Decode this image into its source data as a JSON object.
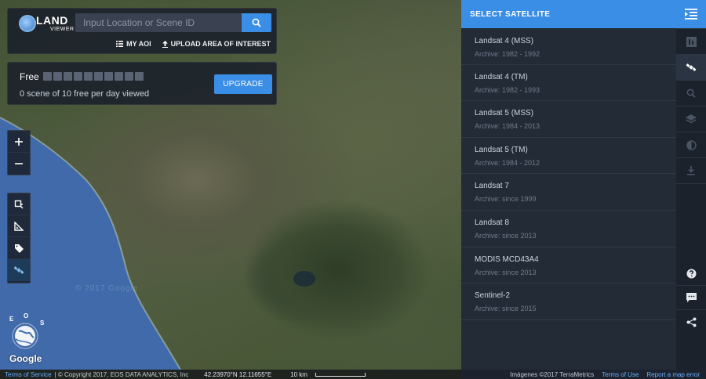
{
  "app": {
    "logo_text": "LAND",
    "logo_sub": "VIEWER"
  },
  "search": {
    "placeholder": "Input Location or Scene ID",
    "my_aoi_label": "MY AOI",
    "upload_label": "UPLOAD AREA OF INTEREST"
  },
  "quota": {
    "label": "Free",
    "used": 0,
    "total": 10,
    "description": "0 scene of 10 free per day viewed",
    "upgrade_label": "UPGRADE"
  },
  "map": {
    "watermark": "© 2017 Google",
    "brand": "Google",
    "eos_letters": [
      "E",
      "O",
      "S"
    ],
    "terms_of_service": "Terms of Service",
    "copyright": "| © Copyright 2017, EOS DATA ANALYTICS, Inc",
    "coordinates": "42.23970°N 12.11655°E",
    "scale_label": "10 km",
    "imagery_credit": "Imágenes ©2017 TerraMetrics",
    "terms_of_use": "Terms of Use",
    "report_error": "Report a map error"
  },
  "satellite_panel": {
    "title": "SELECT SATELLITE",
    "items": [
      {
        "name": "Landsat 4 (MSS)",
        "archive": "Archive: 1982 - 1992"
      },
      {
        "name": "Landsat 4 (TM)",
        "archive": "Archive: 1982 - 1993"
      },
      {
        "name": "Landsat 5 (MSS)",
        "archive": "Archive: 1984 - 2013"
      },
      {
        "name": "Landsat 5 (TM)",
        "archive": "Archive: 1984 - 2012"
      },
      {
        "name": "Landsat 7",
        "archive": "Archive: since 1999"
      },
      {
        "name": "Landsat 8",
        "archive": "Archive: since 2013"
      },
      {
        "name": "MODIS MCD43A4",
        "archive": "Archive: since 2013"
      },
      {
        "name": "Sentinel-2",
        "archive": "Archive: since 2015"
      }
    ]
  },
  "colors": {
    "accent": "#3a8ee6",
    "panel_bg": "#232b37",
    "strip_bg": "#1b222c"
  },
  "icons": {
    "map_tools": [
      "plus-icon",
      "minus-icon",
      "crop-icon",
      "ruler-icon",
      "tag-icon",
      "satellite-icon"
    ],
    "right_strip": [
      "collapse-panel-icon",
      "grid-icon",
      "satellite-icon",
      "search-icon",
      "layers-icon",
      "contrast-icon",
      "download-icon",
      "help-icon",
      "chat-icon",
      "share-icon"
    ]
  }
}
